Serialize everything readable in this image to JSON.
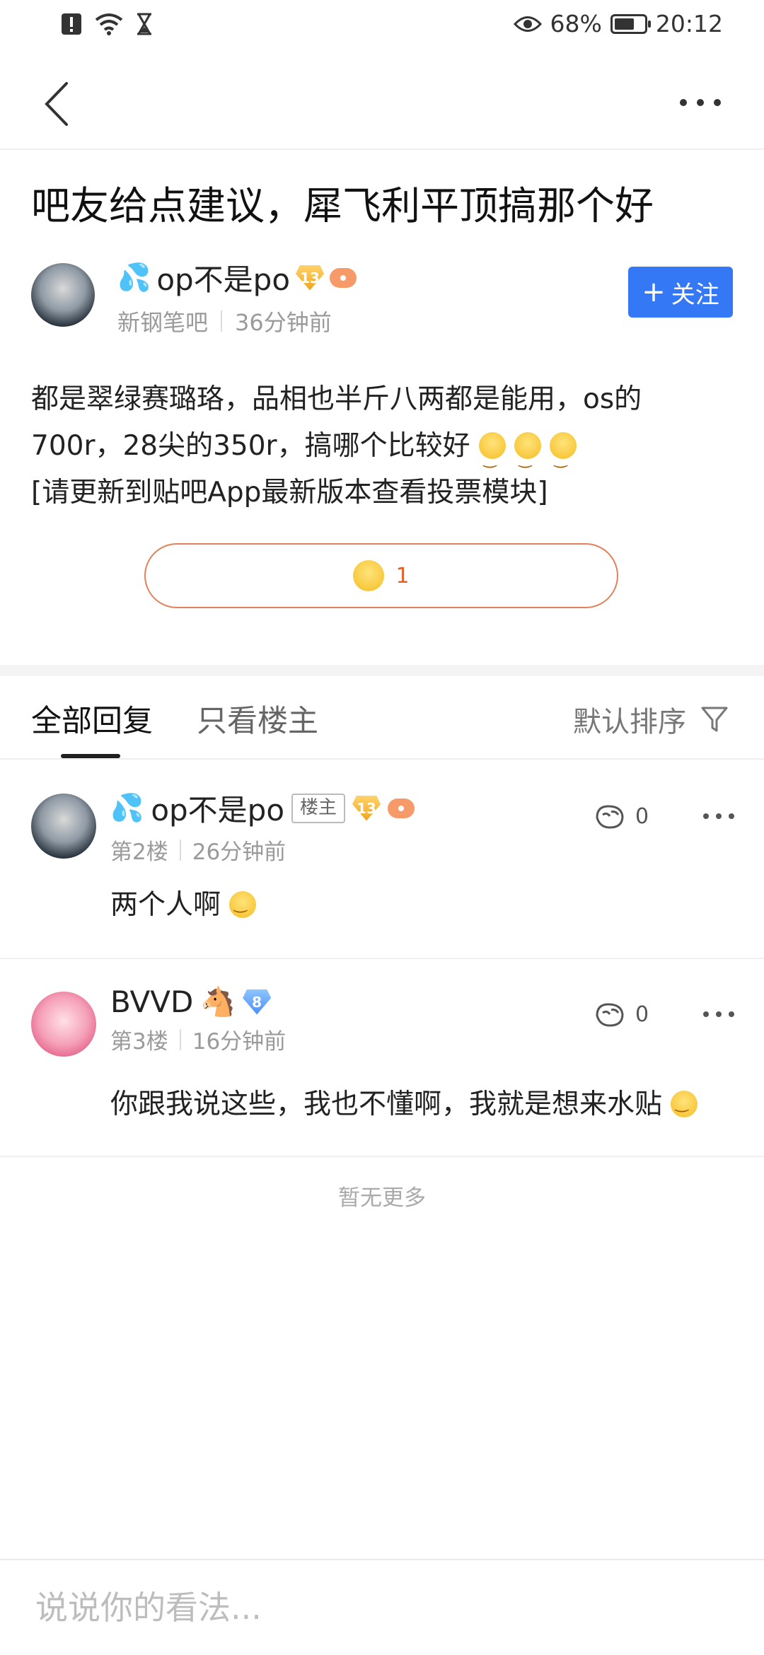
{
  "status_bar": {
    "battery_percent_label": "68%",
    "battery_level": 0.68,
    "time": "20:12"
  },
  "post": {
    "title": "吧友给点建议，犀飞利平顶搞那个好",
    "author": {
      "name": "op不是po",
      "level": "13",
      "forum": "新钢笔吧",
      "time": "36分钟前"
    },
    "follow_label": "关注",
    "body_lines": [
      "都是翠绿赛璐珞，品相也半斤八两都是能用，os的",
      "700r，28尖的350r，搞哪个比较好",
      "[请更新到贴吧App最新版本查看投票模块]"
    ],
    "reaction_count": "1"
  },
  "tabs": {
    "all": "全部回复",
    "op_only": "只看楼主",
    "sort": "默认排序"
  },
  "replies": [
    {
      "name": "op不是po",
      "tag": "楼主",
      "level": "13",
      "floor": "第2楼",
      "time": "26分钟前",
      "content": "两个人啊",
      "likes": "0"
    },
    {
      "name": "BVVD",
      "level": "8",
      "floor": "第3楼",
      "time": "16分钟前",
      "content": "你跟我说这些，我也不懂啊，我就是想来水贴",
      "likes": "0"
    }
  ],
  "no_more": "暂无更多",
  "input": {
    "placeholder": "说说你的看法..."
  },
  "colors": {
    "accent": "#3478f6",
    "vote_border": "#e48059",
    "level_badge_gold": "#f0a41b",
    "level_badge_blue": "#4c8ef7"
  }
}
